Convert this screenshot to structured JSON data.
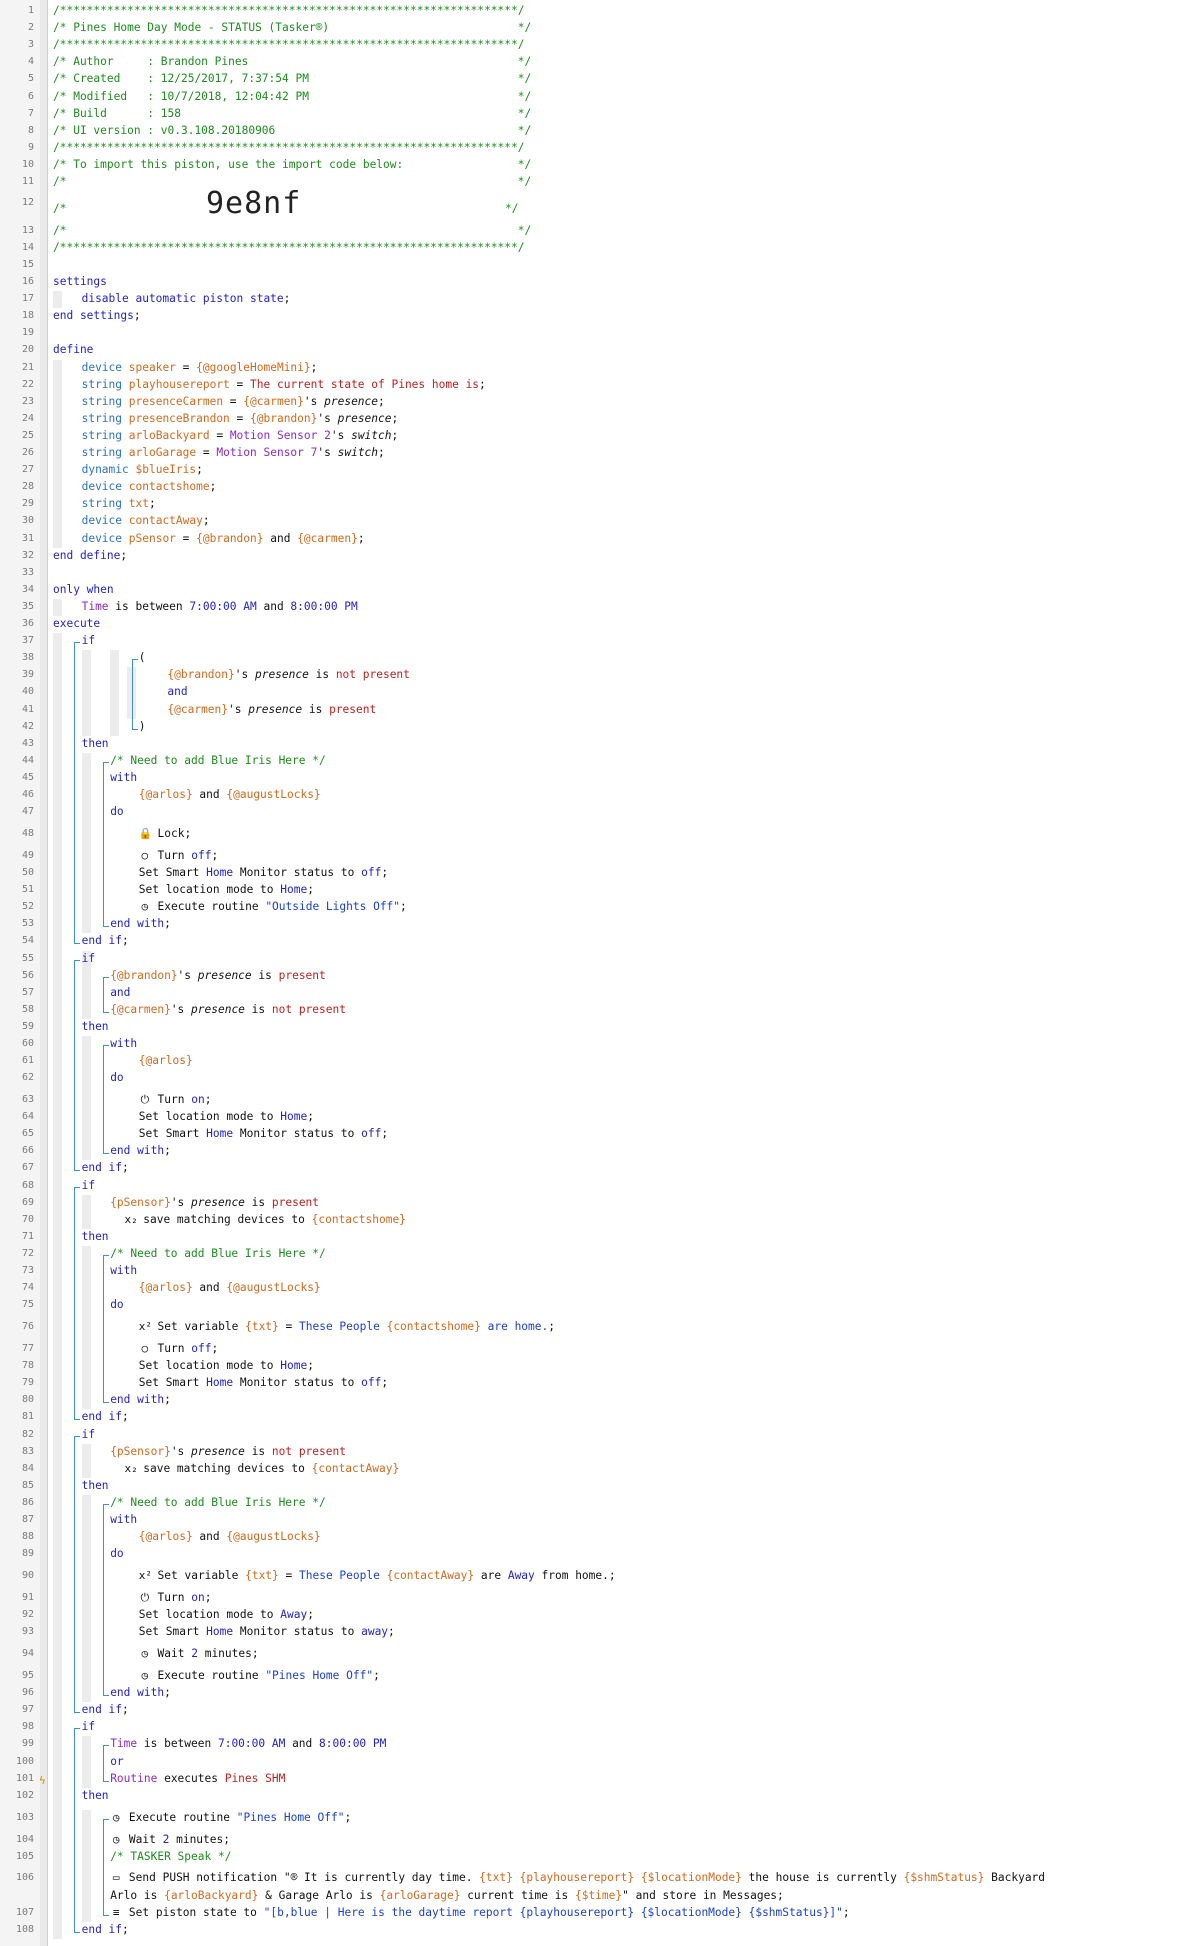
{
  "lines": [
    [
      "/********************************************************************/"
    ],
    [
      "/* Pines Home Day Mode - STATUS (Tasker®)                            */"
    ],
    [
      "/********************************************************************/"
    ],
    [
      "/* Author     : Brandon Pines                                        */"
    ],
    [
      "/* Created    : 12/25/2017, 7:37:54 PM                               */"
    ],
    [
      "/* Modified   : 10/7/2018, 12:04:42 PM                               */"
    ],
    [
      "/* Build      : 158                                                  */"
    ],
    [
      "/* UI version : v0.3.108.20180906                                    */"
    ],
    [
      "/********************************************************************/"
    ],
    [
      "/* To import this piston, use the import code below:                 */"
    ],
    [
      "/*                                                                   */"
    ],
    [
      "/*                9e8nf                                              */"
    ],
    [
      "/*                                                                   */"
    ],
    [
      "/********************************************************************/"
    ],
    [
      ""
    ],
    [
      "settings"
    ],
    [
      "disable automatic piston state;"
    ],
    [
      "end settings;"
    ],
    [
      ""
    ],
    [
      "define"
    ],
    [
      "device speaker = {@googleHomeMini};"
    ],
    [
      "string playhousereport = The current state of Pines home is;"
    ],
    [
      "string presenceCarmen = {@carmen}'s presence;"
    ],
    [
      "string presenceBrandon = {@brandon}'s presence;"
    ],
    [
      "string arloBackyard = Motion Sensor 2's switch;"
    ],
    [
      "string arloGarage = Motion Sensor 7's switch;"
    ],
    [
      "dynamic $blueIris;"
    ],
    [
      "device contactshome;"
    ],
    [
      "string txt;"
    ],
    [
      "device contactAway;"
    ],
    [
      "device pSensor = {@brandon} and {@carmen};"
    ],
    [
      "end define;"
    ],
    [
      ""
    ],
    [
      "only when"
    ],
    [
      "Time is between 7:00:00 AM and 8:00:00 PM"
    ],
    [
      "execute"
    ],
    [
      "if"
    ],
    [
      "("
    ],
    [
      "{@brandon}'s presence is not present"
    ],
    [
      "and"
    ],
    [
      "{@carmen}'s presence is present"
    ],
    [
      ")"
    ],
    [
      "then"
    ],
    [
      "/* Need to add Blue Iris Here */"
    ],
    [
      "with"
    ],
    [
      "{@arlos} and {@augustLocks}"
    ],
    [
      "do"
    ],
    [
      "Lock;"
    ],
    [
      "Turn off;"
    ],
    [
      "Set Smart Home Monitor status to off;"
    ],
    [
      "Set location mode to Home;"
    ],
    [
      "Execute routine \"Outside Lights Off\";"
    ],
    [
      "end with;"
    ],
    [
      "end if;"
    ],
    [
      "if"
    ],
    [
      "{@brandon}'s presence is present"
    ],
    [
      "and"
    ],
    [
      "{@carmen}'s presence is not present"
    ],
    [
      "then"
    ],
    [
      "with"
    ],
    [
      "{@arlos}"
    ],
    [
      "do"
    ],
    [
      "Turn on;"
    ],
    [
      "Set location mode to Home;"
    ],
    [
      "Set Smart Home Monitor status to off;"
    ],
    [
      "end with;"
    ],
    [
      "end if;"
    ],
    [
      "if"
    ],
    [
      "{pSensor}'s presence is present"
    ],
    [
      "save matching devices to {contactshome}"
    ],
    [
      "then"
    ],
    [
      "/* Need to add Blue Iris Here */"
    ],
    [
      "with"
    ],
    [
      "{@arlos} and {@augustLocks}"
    ],
    [
      "do"
    ],
    [
      "Set variable {txt} = These People {contactshome} are home.;"
    ],
    [
      "Turn off;"
    ],
    [
      "Set location mode to Home;"
    ],
    [
      "Set Smart Home Monitor status to off;"
    ],
    [
      "end with;"
    ],
    [
      "end if;"
    ],
    [
      "if"
    ],
    [
      "{pSensor}'s presence is not present"
    ],
    [
      "save matching devices to {contactAway}"
    ],
    [
      "then"
    ],
    [
      "/* Need to add Blue Iris Here */"
    ],
    [
      "with"
    ],
    [
      "{@arlos} and {@augustLocks}"
    ],
    [
      "do"
    ],
    [
      "Set variable {txt} = These People {contactAway} are Away from home.;"
    ],
    [
      "Turn on;"
    ],
    [
      "Set location mode to Away;"
    ],
    [
      "Set Smart Home Monitor status to away;"
    ],
    [
      "Wait 2 minutes;"
    ],
    [
      "Execute routine \"Pines Home Off\";"
    ],
    [
      "end with;"
    ],
    [
      "end if;"
    ],
    [
      "if"
    ],
    [
      "Time is between 7:00:00 AM and 8:00:00 PM"
    ],
    [
      "or"
    ],
    [
      "Routine executes Pines SHM"
    ],
    [
      "then"
    ],
    [
      "Execute routine \"Pines Home Off\";"
    ],
    [
      "Wait 2 minutes;"
    ],
    [
      "/* TASKER Speak */"
    ],
    [
      "Send PUSH notification \"® It is currently day time. {txt} {playhousereport} {$locationMode} the house is currently {$shmStatus} Backyard",
      "Arlo is {arloBackyard} & Garage Arlo is {arloGarage} current time is {$time}\" and store in Messages;"
    ],
    [
      "Set piston state to \"[b,blue | Here is the daytime report {playhousereport} {$locationMode} {$shmStatus}]\";"
    ],
    [
      "end if;"
    ]
  ],
  "icons": {
    "48": "lock-icon",
    "49": "power-off-icon",
    "52": "clock-icon",
    "63": "power-on-icon",
    "70": "subscript-icon",
    "76": "superscript-icon",
    "77": "power-off-icon",
    "84": "subscript-icon",
    "90": "superscript-icon",
    "91": "power-on-icon",
    "94": "clock-icon",
    "95": "clock-icon",
    "103": "clock-icon",
    "104": "clock-icon",
    "106": "chat-icon",
    "107": "list-icon"
  },
  "colors": {
    "comment": "#1d8c1d",
    "keyword": "#2222cc",
    "type": "#2b72c6",
    "variable": "#d2691e",
    "value": "#c0201e",
    "device": "#8a2bc6",
    "string": "#1a3fd6"
  }
}
